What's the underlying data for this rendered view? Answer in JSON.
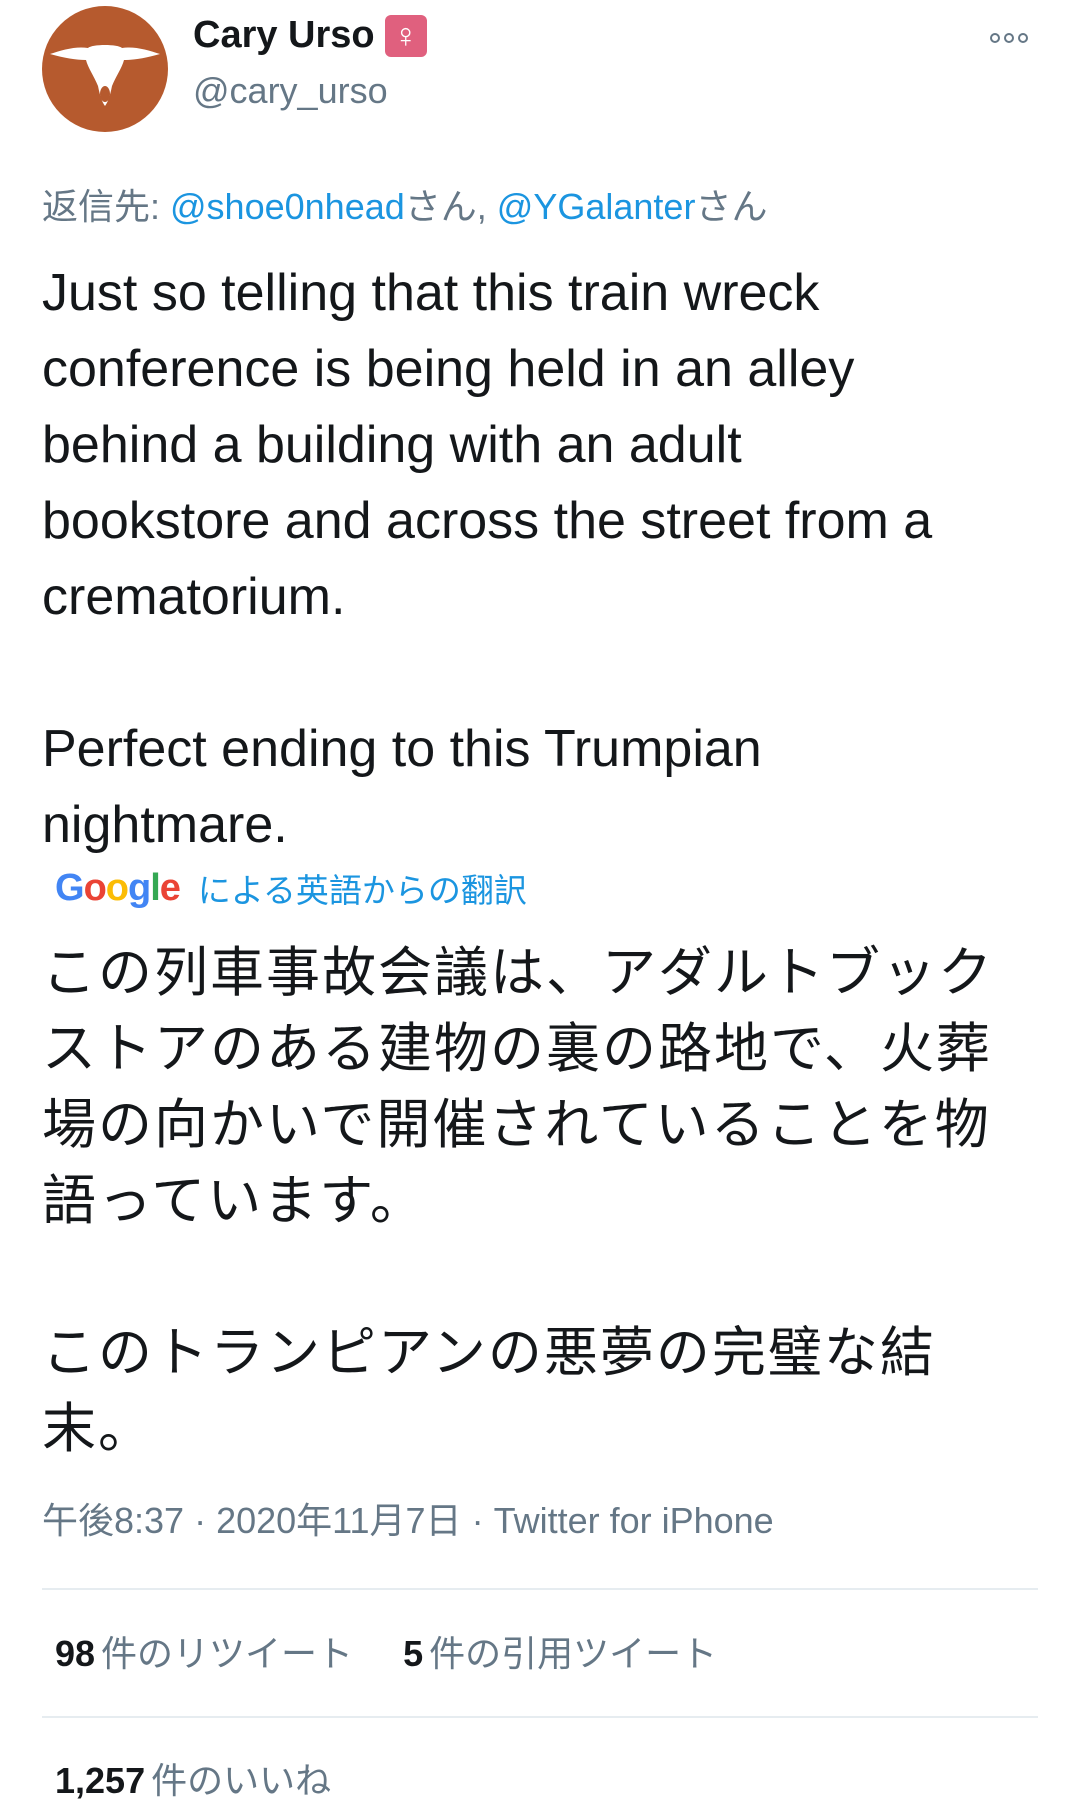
{
  "tweet": {
    "display_name": "Cary Urso",
    "badge": "♀",
    "handle": "@cary_urso",
    "reply_prefix": "返信先: ",
    "reply_mentions": [
      "@shoe0nhead",
      "@YGalanter"
    ],
    "reply_suffix": "さん",
    "reply_separator": ", ",
    "text": "Just so telling that this train wreck\nconference is being held in an alley\nbehind a building with an adult\nbookstore and across the street from a\ncrematorium.\n\nPerfect ending to this Trumpian\nnightmare.",
    "translation_provider": "Google",
    "translation_label": "による英語からの翻訳",
    "translated_text": "この列車事故会議は、アダルトブック\nストアのある建物の裏の路地で、火葬\n場の向かいで開催されていることを物\n語っています。\n\nこのトランピアンの悪夢の完璧な結\n末。",
    "time": "午後8:37",
    "date": "2020年11月7日",
    "source": "Twitter for iPhone",
    "meta_separator": " · "
  },
  "stats": {
    "retweets": {
      "count": "98",
      "label": "件のリツイート"
    },
    "quotes": {
      "count": "5",
      "label": "件の引用ツイート"
    },
    "likes": {
      "count": "1,257",
      "label": "件のいいね"
    }
  },
  "colors": {
    "link": "#1b95e0",
    "secondary_text": "#657786",
    "avatar_bg": "#b65a2e",
    "badge_bg": "#e0607e"
  },
  "icons": {
    "avatar": "longhorn-icon",
    "more": "more-options-icon"
  }
}
